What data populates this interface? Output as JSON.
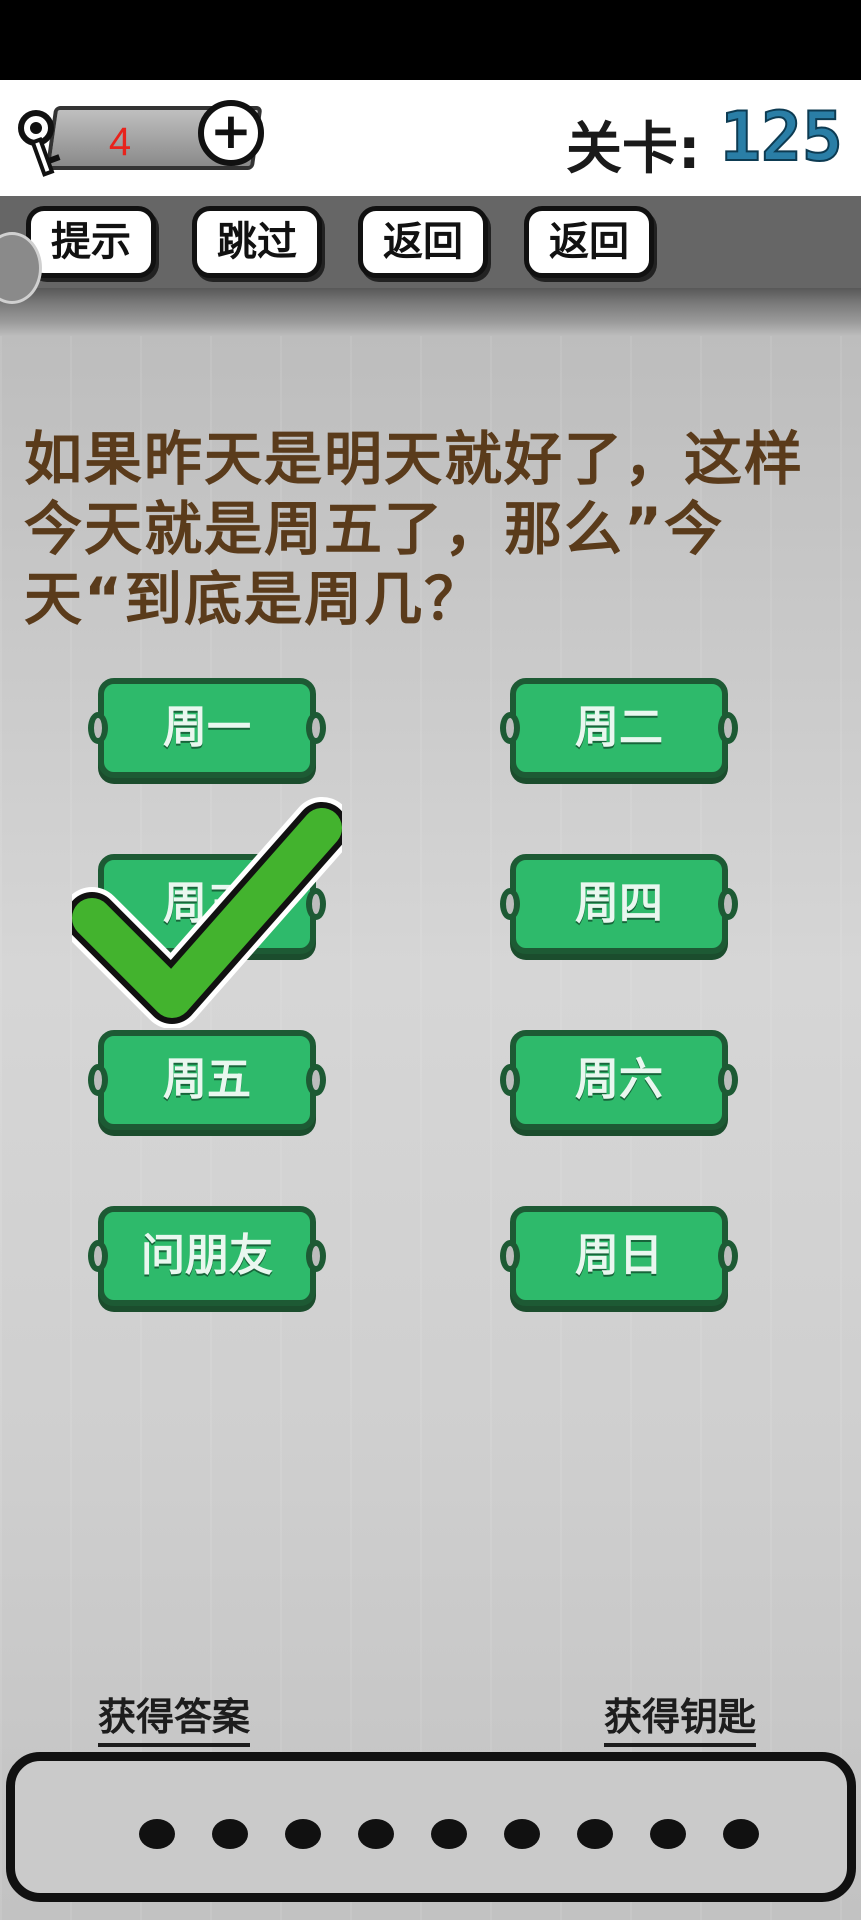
{
  "header": {
    "key_count": "4",
    "level_label": "关卡:",
    "level_number": "125"
  },
  "toolbar": {
    "buttons": [
      "提示",
      "跳过",
      "返回",
      "返回"
    ]
  },
  "question": "如果昨天是明天就好了，这样今天就是周五了，那么”今天“到底是周几？",
  "options": [
    "周一",
    "周二",
    "周三",
    "周四",
    "周五",
    "周六",
    "问朋友",
    "周日"
  ],
  "selected_option": "周三",
  "footer": {
    "get_answer": "获得答案",
    "get_key": "获得钥匙",
    "answer_slots": 9
  },
  "colors": {
    "option_green": "#2eba6b",
    "option_border": "#1d5a34",
    "question_text": "#5a3b1b",
    "level_number": "#2a7ea6",
    "key_count": "#e8231c",
    "checkmark": "#43b32e"
  }
}
